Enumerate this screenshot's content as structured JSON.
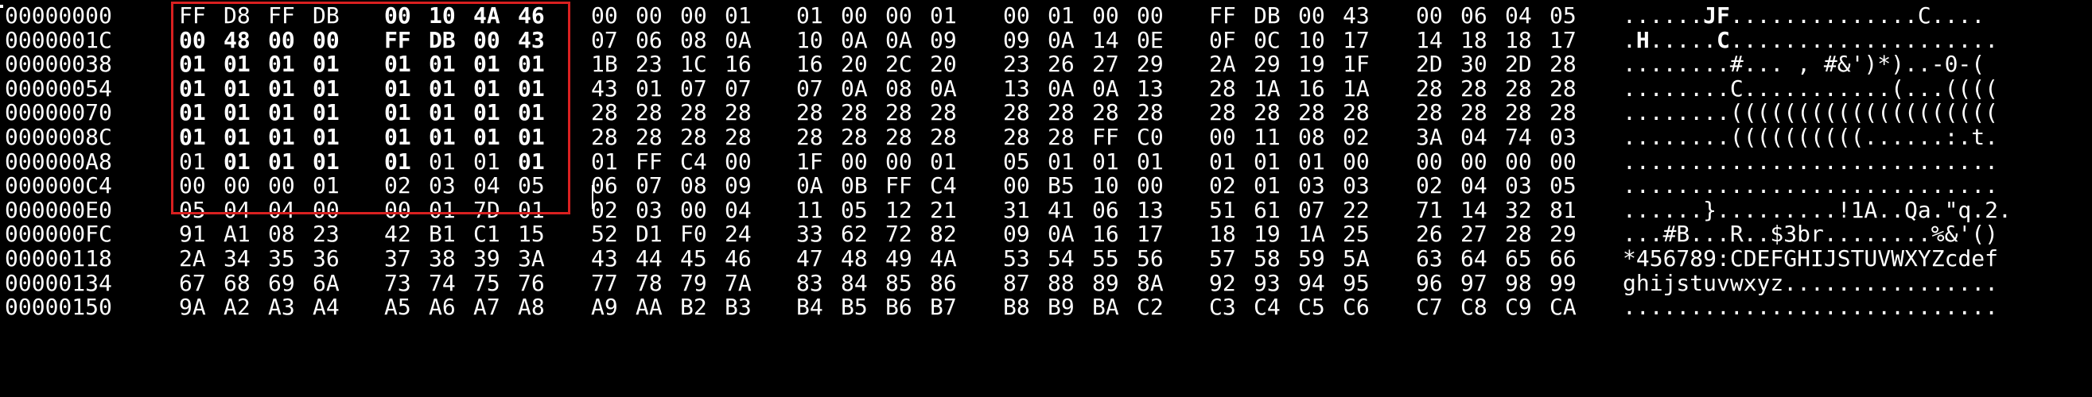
{
  "hex_editor": {
    "selection_color": "#d92020",
    "background_color": "#000000",
    "text_color": "#ffffff",
    "rows": [
      {
        "offset": "00000000",
        "bytes": [
          "FF",
          "D8",
          "FF",
          "DB",
          "00",
          "10",
          "4A",
          "46",
          "00",
          "00",
          "00",
          "01",
          "01",
          "00",
          "00",
          "01",
          "00",
          "01",
          "00",
          "00",
          "FF",
          "DB",
          "00",
          "43",
          "00",
          "06",
          "04",
          "05"
        ],
        "ascii": "......JF..............C...."
      },
      {
        "offset": "0000001C",
        "bytes": [
          "00",
          "48",
          "00",
          "00",
          "FF",
          "DB",
          "00",
          "43",
          "07",
          "06",
          "08",
          "0A",
          "10",
          "0A",
          "0A",
          "09",
          "09",
          "0A",
          "14",
          "0E",
          "0F",
          "0C",
          "10",
          "17",
          "14",
          "18",
          "18",
          "17"
        ],
        "ascii": ".H.....C...................."
      },
      {
        "offset": "00000038",
        "bytes": [
          "01",
          "01",
          "01",
          "01",
          "01",
          "01",
          "01",
          "01",
          "1B",
          "23",
          "1C",
          "16",
          "16",
          "20",
          "2C",
          "20",
          "23",
          "26",
          "27",
          "29",
          "2A",
          "29",
          "19",
          "1F",
          "2D",
          "30",
          "2D",
          "28"
        ],
        "ascii": "........#... , #&')*)..-0-("
      },
      {
        "offset": "00000054",
        "bytes": [
          "01",
          "01",
          "01",
          "01",
          "01",
          "01",
          "01",
          "01",
          "43",
          "01",
          "07",
          "07",
          "07",
          "0A",
          "08",
          "0A",
          "13",
          "0A",
          "0A",
          "13",
          "28",
          "1A",
          "16",
          "1A",
          "28",
          "28",
          "28",
          "28"
        ],
        "ascii": "........C...........(...(((("
      },
      {
        "offset": "00000070",
        "bytes": [
          "01",
          "01",
          "01",
          "01",
          "01",
          "01",
          "01",
          "01",
          "28",
          "28",
          "28",
          "28",
          "28",
          "28",
          "28",
          "28",
          "28",
          "28",
          "28",
          "28",
          "28",
          "28",
          "28",
          "28",
          "28",
          "28",
          "28",
          "28"
        ],
        "ascii": "........(((((((((((((((((((("
      },
      {
        "offset": "0000008C",
        "bytes": [
          "01",
          "01",
          "01",
          "01",
          "01",
          "01",
          "01",
          "01",
          "28",
          "28",
          "28",
          "28",
          "28",
          "28",
          "28",
          "28",
          "28",
          "28",
          "FF",
          "C0",
          "00",
          "11",
          "08",
          "02",
          "3A",
          "04",
          "74",
          "03"
        ],
        "ascii": "........((((((((((......:.t."
      },
      {
        "offset": "000000A8",
        "bytes": [
          "01",
          "01",
          "01",
          "01",
          "01",
          "01",
          "01",
          "01",
          "01",
          "FF",
          "C4",
          "00",
          "1F",
          "00",
          "00",
          "01",
          "05",
          "01",
          "01",
          "01",
          "01",
          "01",
          "01",
          "00",
          "00",
          "00",
          "00",
          "00"
        ],
        "ascii": "............................"
      },
      {
        "offset": "000000C4",
        "bytes": [
          "00",
          "00",
          "00",
          "01",
          "02",
          "03",
          "04",
          "05",
          "06",
          "07",
          "08",
          "09",
          "0A",
          "0B",
          "FF",
          "C4",
          "00",
          "B5",
          "10",
          "00",
          "02",
          "01",
          "03",
          "03",
          "02",
          "04",
          "03",
          "05"
        ],
        "ascii": "............................"
      },
      {
        "offset": "000000E0",
        "bytes": [
          "05",
          "04",
          "04",
          "00",
          "00",
          "01",
          "7D",
          "01",
          "02",
          "03",
          "00",
          "04",
          "11",
          "05",
          "12",
          "21",
          "31",
          "41",
          "06",
          "13",
          "51",
          "61",
          "07",
          "22",
          "71",
          "14",
          "32",
          "81"
        ],
        "ascii": "......}.........!1A..Qa.\"q.2."
      },
      {
        "offset": "000000FC",
        "bytes": [
          "91",
          "A1",
          "08",
          "23",
          "42",
          "B1",
          "C1",
          "15",
          "52",
          "D1",
          "F0",
          "24",
          "33",
          "62",
          "72",
          "82",
          "09",
          "0A",
          "16",
          "17",
          "18",
          "19",
          "1A",
          "25",
          "26",
          "27",
          "28",
          "29"
        ],
        "ascii": "...#B...R..$3br........%&'()"
      },
      {
        "offset": "00000118",
        "bytes": [
          "2A",
          "34",
          "35",
          "36",
          "37",
          "38",
          "39",
          "3A",
          "43",
          "44",
          "45",
          "46",
          "47",
          "48",
          "49",
          "4A",
          "53",
          "54",
          "55",
          "56",
          "57",
          "58",
          "59",
          "5A",
          "63",
          "64",
          "65",
          "66"
        ],
        "ascii": "*456789:CDEFGHIJSTUVWXYZcdef"
      },
      {
        "offset": "00000134",
        "bytes": [
          "67",
          "68",
          "69",
          "6A",
          "73",
          "74",
          "75",
          "76",
          "77",
          "78",
          "79",
          "7A",
          "83",
          "84",
          "85",
          "86",
          "87",
          "88",
          "89",
          "8A",
          "92",
          "93",
          "94",
          "95",
          "96",
          "97",
          "98",
          "99"
        ],
        "ascii": "ghijstuvwxyz................"
      },
      {
        "offset": "00000150",
        "bytes": [
          "9A",
          "A2",
          "A3",
          "A4",
          "A5",
          "A6",
          "A7",
          "A8",
          "A9",
          "AA",
          "B2",
          "B3",
          "B4",
          "B5",
          "B6",
          "B7",
          "B8",
          "B9",
          "BA",
          "C2",
          "C3",
          "C4",
          "C5",
          "C6",
          "C7",
          "C8",
          "C9",
          "CA"
        ],
        "ascii": "............................"
      }
    ]
  }
}
